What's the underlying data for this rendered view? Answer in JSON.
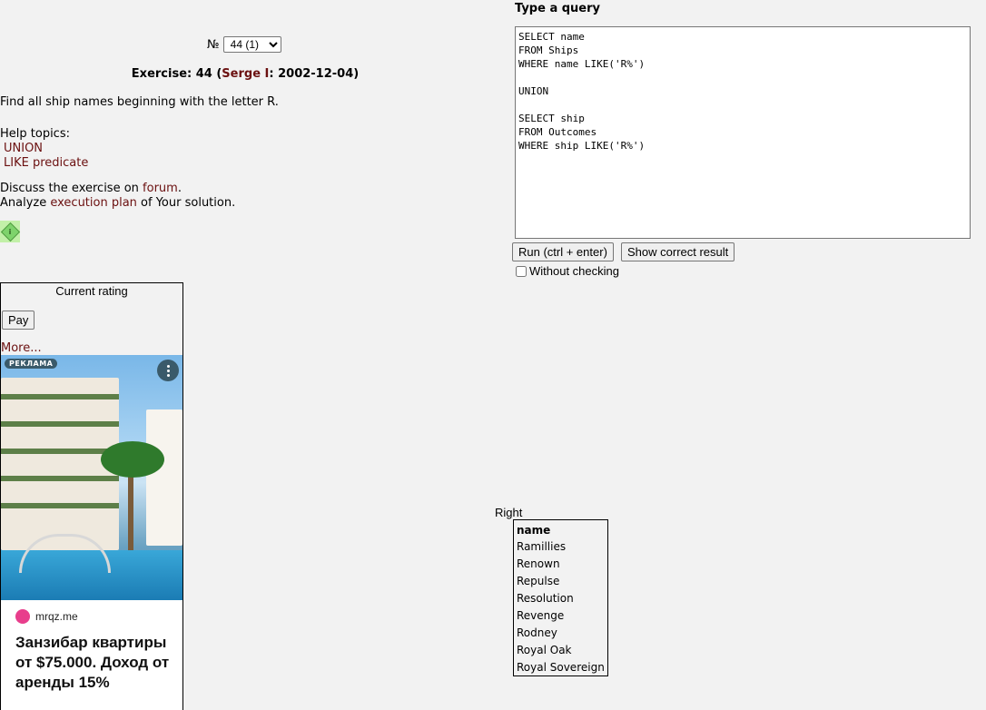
{
  "exercise": {
    "number_label": "№",
    "selected": "44 (1)",
    "title_prefix": "Exercise: 44 (",
    "author": "Serge I",
    "title_suffix": ": 2002-12-04)",
    "task": "Find all ship names beginning with the letter R."
  },
  "help": {
    "label": "Help topics:",
    "topics": [
      "UNION",
      "LIKE predicate"
    ]
  },
  "discuss": {
    "line1_prefix": "Discuss the exercise on ",
    "forum_link": "forum",
    "line1_suffix": ".",
    "line2_prefix": "Analyze ",
    "plan_link": "execution plan",
    "line2_suffix": " of Your solution."
  },
  "sidebar": {
    "rating_title": "Current rating",
    "pay_label": "Pay",
    "more_label": "More..."
  },
  "ad": {
    "badge": "РЕКЛАМА",
    "domain": "mrqz.me",
    "headline": "Занзибар квартиры от $75.000. Доход от аренды 15%"
  },
  "query": {
    "label": "Type a query",
    "text": "SELECT name\nFROM Ships\nWHERE name LIKE('R%')\n\nUNION\n\nSELECT ship\nFROM Outcomes\nWHERE ship LIKE('R%')",
    "run_label": "Run (ctrl + enter)",
    "show_label": "Show correct result",
    "nocheck_label": "Without checking"
  },
  "result": {
    "status": "Right",
    "header": "name",
    "rows": [
      "Ramillies",
      "Renown",
      "Repulse",
      "Resolution",
      "Revenge",
      "Rodney",
      "Royal Oak",
      "Royal Sovereign"
    ]
  },
  "icons": {
    "hint": "diamond-icon",
    "ad_menu": "more-vertical-icon"
  },
  "colors": {
    "link": "#6b1010",
    "hint_bg": "#c2f0a8"
  }
}
